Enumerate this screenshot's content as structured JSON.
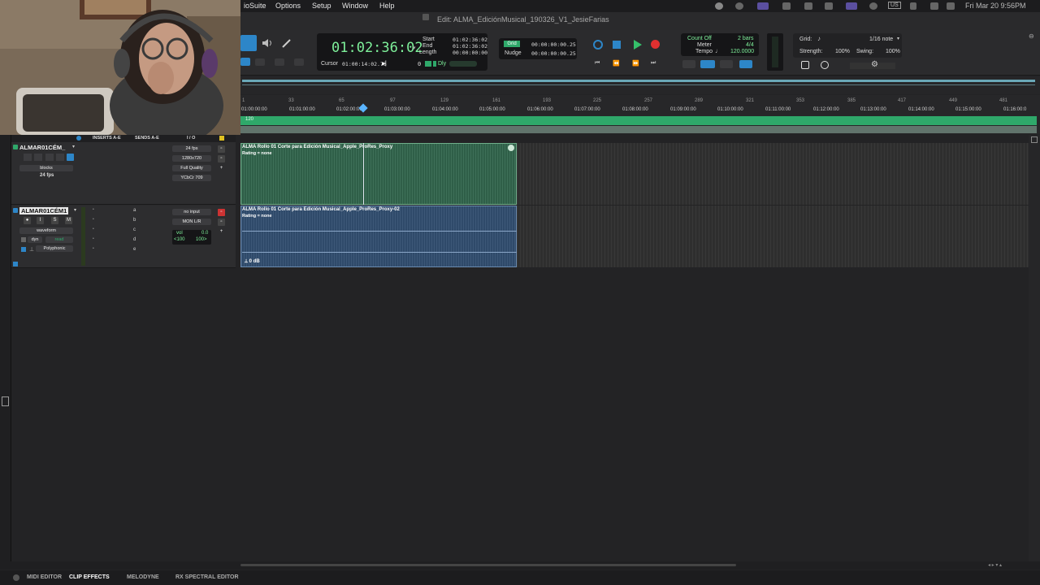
{
  "menubar": {
    "items": [
      "ioSuite",
      "Options",
      "Setup",
      "Window",
      "Help"
    ],
    "clock": "Fri Mar 20  9:56PM",
    "keyboard": "US"
  },
  "window": {
    "title": "Edit: ALMA_EdiciónMusical_190326_V1_JesieFarias"
  },
  "transport": {
    "main_counter": "01:02:36:02",
    "start_label": "Start",
    "end_label": "End",
    "length_label": "Length",
    "start_value": "01:02:36:02",
    "end_value": "01:02:36:02",
    "length_value": "00:00:00:00",
    "cursor_label": "Cursor",
    "cursor_value": "01:00:14:02.75",
    "zero_value": "0",
    "dly_label": "Dly",
    "grid_label": "Grid",
    "grid_value": "00:00:00:00.25",
    "nudge_label": "Nudge",
    "nudge_value": "00:00:00:00.25",
    "count_off_label": "Count Off",
    "count_off_value": "2 bars",
    "meter_label": "Meter",
    "meter_value": "4/4",
    "tempo_label": "Tempo",
    "tempo_value": "120.0000"
  },
  "grid_panel": {
    "grid_label": "Grid:",
    "grid_note": "1/16 note",
    "strength_label": "Strength:",
    "strength_value": "100%",
    "swing_label": "Swing:",
    "swing_value": "100%"
  },
  "rulers": {
    "bars": [
      "1",
      "33",
      "65",
      "97",
      "129",
      "161",
      "193",
      "225",
      "257",
      "289",
      "321",
      "353",
      "385",
      "417",
      "449",
      "481"
    ],
    "timecodes": [
      "01:00:00:00",
      "01:01:00:00",
      "01:02:00:00",
      "01:03:00:00",
      "01:04:00:00",
      "01:05:00:00",
      "01:06:00:00",
      "01:07:00:00",
      "01:08:00:00",
      "01:09:00:00",
      "01:10:00:00",
      "01:11:00:00",
      "01:12:00:00",
      "01:13:00:00",
      "01:14:00:00",
      "01:15:00:00",
      "01:16:00:0"
    ],
    "tempo_marker": "120"
  },
  "columns": {
    "inserts": "INSERTS A-E",
    "sends": "SENDS A-E",
    "io": "I / O"
  },
  "tracks": [
    {
      "name": "ALMAR01CÉM_",
      "view": "blocks",
      "fps_label": "24 fps",
      "io_fps": "24 fps",
      "io_res": "1280x720",
      "io_quality": "Full Quality",
      "io_color": "YCbCr 709",
      "clip_name": "ALMA Rollo 01 Corte para Edición Musical_Apple_ProRes_Proxy",
      "clip_rating": "Rating = none"
    },
    {
      "name": "ALMAR01CÉM1",
      "view": "waveform",
      "automation": "read",
      "dyn_label": "dyn",
      "voice": "Polyphonic",
      "buttons": [
        "I",
        "S",
        "M"
      ],
      "sends": [
        "a",
        "b",
        "c",
        "d",
        "e"
      ],
      "io_in": "no input",
      "io_out": "MON L/R",
      "vol_label": "vol",
      "vol_value": "0.0",
      "pan_left": "<100",
      "pan_right": "100>",
      "clip_name": "ALMA Rollo 01 Corte para Edición Musical_Apple_ProRes_Proxy-02",
      "clip_rating": "Rating = none",
      "clip_gain": "0 dB"
    }
  ],
  "bottom_tabs": [
    "MIDI EDITOR",
    "CLIP EFFECTS",
    "MELODYNE",
    "RX SPECTRAL EDITOR"
  ],
  "colors": {
    "accent_green": "#2fa86a",
    "video_clip": "#2f5f48",
    "audio_clip": "#2f4a6a",
    "record_red": "#e03030",
    "play_green": "#35c06a",
    "tool_blue": "#2d86c8"
  }
}
